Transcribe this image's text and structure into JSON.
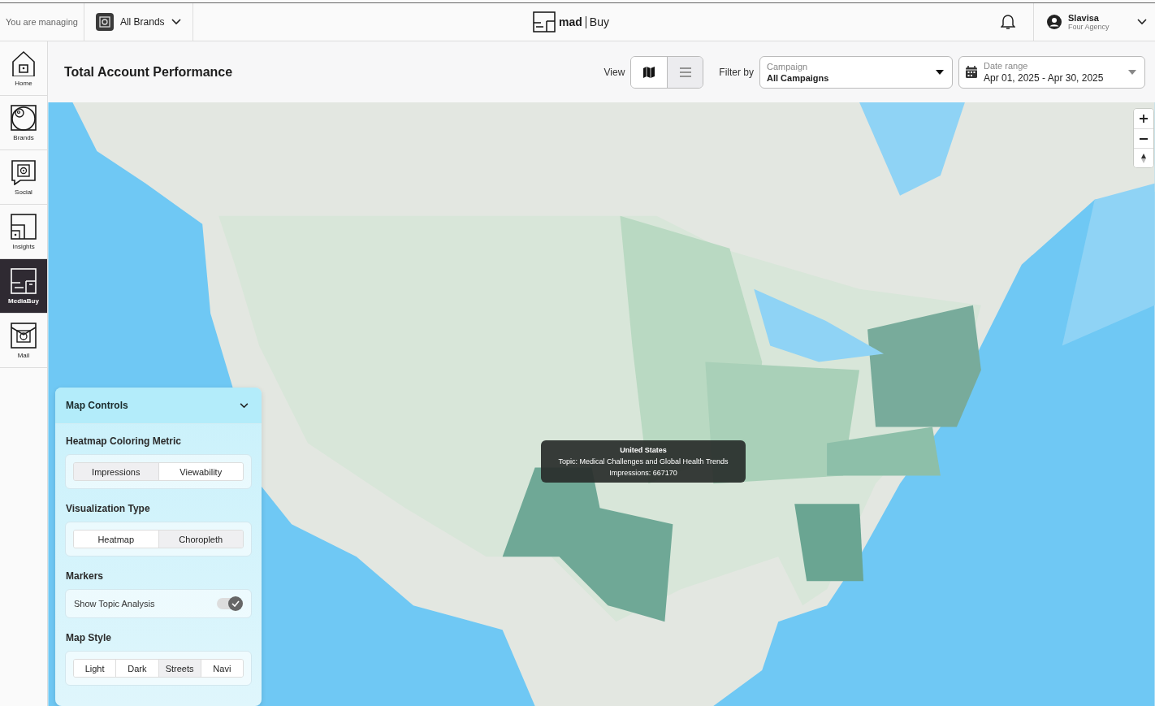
{
  "top_bar": {
    "managing_label": "You are managing",
    "brand_selector": "All Brands",
    "logo": {
      "word": "mad",
      "suffix": "Buy"
    },
    "user": {
      "name": "Slavisa",
      "org": "Four Agency"
    }
  },
  "sidebar": {
    "items": [
      {
        "label": "Home",
        "selected": false
      },
      {
        "label": "Brands",
        "selected": false
      },
      {
        "label": "Social",
        "selected": false
      },
      {
        "label": "Insights",
        "selected": false
      },
      {
        "label": "MediaBuy",
        "selected": true
      },
      {
        "label": "Mail",
        "selected": false
      }
    ]
  },
  "header": {
    "title": "Total Account Performance",
    "view_label": "View",
    "views": [
      {
        "kind": "map",
        "selected": true
      },
      {
        "kind": "list",
        "selected": false
      }
    ],
    "filter_label": "Filter by",
    "campaign": {
      "label": "Campaign",
      "value": "All Campaigns"
    },
    "date_range": {
      "label": "Date range",
      "value": "Apr 01, 2025 - Apr 30, 2025"
    }
  },
  "map": {
    "kind": "picture",
    "tooltip": {
      "title": "United States",
      "lines": [
        "Topic: Medical Challenges and Global Health Trends",
        "Impressions: 667170"
      ]
    },
    "controls": {
      "title": "Map Controls",
      "expanded": true,
      "sections": [
        {
          "title": "Heatmap Coloring Metric",
          "kind": "segments",
          "options": [
            {
              "label": "Impressions",
              "selected": true
            },
            {
              "label": "Viewability",
              "selected": false
            }
          ]
        },
        {
          "title": "Visualization Type",
          "kind": "segments",
          "options": [
            {
              "label": "Heatmap",
              "selected": false
            },
            {
              "label": "Choropleth",
              "selected": true
            }
          ]
        },
        {
          "title": "Markers",
          "kind": "toggle",
          "label": "Show Topic Analysis",
          "on": true
        },
        {
          "title": "Map Style",
          "kind": "segments",
          "options": [
            {
              "label": "Light",
              "selected": false
            },
            {
              "label": "Dark",
              "selected": false
            },
            {
              "label": "Streets",
              "selected": true
            },
            {
              "label": "Navi",
              "selected": false
            }
          ]
        }
      ]
    }
  }
}
